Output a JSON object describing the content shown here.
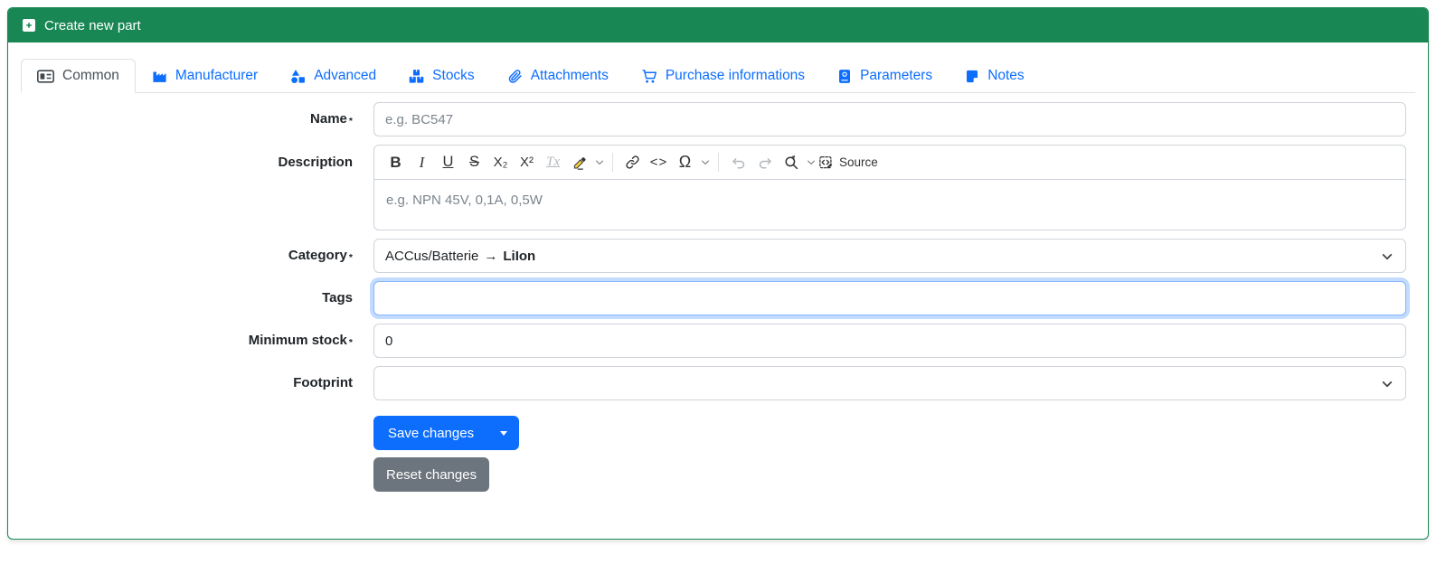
{
  "window": {
    "title": "Create new part"
  },
  "colors": {
    "header_green": "#198754",
    "tab_link_blue": "#0d6efd",
    "primary_button_blue": "#0d6efd",
    "secondary_button_gray": "#6c757d",
    "focus_ring_blue": "#86b7fe"
  },
  "tabs": [
    {
      "label": "Common",
      "icon": "address-card-icon",
      "active": true
    },
    {
      "label": "Manufacturer",
      "icon": "factory-icon",
      "active": false
    },
    {
      "label": "Advanced",
      "icon": "shapes-icon",
      "active": false
    },
    {
      "label": "Stocks",
      "icon": "boxes-stacked-icon",
      "active": false
    },
    {
      "label": "Attachments",
      "icon": "paperclip-icon",
      "active": false
    },
    {
      "label": "Purchase informations",
      "icon": "shopping-cart-icon",
      "active": false
    },
    {
      "label": "Parameters",
      "icon": "address-book-icon",
      "active": false
    },
    {
      "label": "Notes",
      "icon": "sticky-note-icon",
      "active": false
    }
  ],
  "form": {
    "name": {
      "label": "Name",
      "required": "*",
      "placeholder": "e.g. BC547",
      "value": ""
    },
    "description": {
      "label": "Description",
      "placeholder": "e.g. NPN 45V, 0,1A, 0,5W",
      "value": ""
    },
    "category": {
      "label": "Category",
      "required": "*",
      "value_path": "ACCus/Batterie",
      "value_arrow": "→",
      "value_selected": "LiIon"
    },
    "tags": {
      "label": "Tags",
      "value": "",
      "focused": true
    },
    "minimum_stock": {
      "label": "Minimum stock",
      "required": "*",
      "value": "0"
    },
    "footprint": {
      "label": "Footprint",
      "value": ""
    }
  },
  "editor_toolbar": {
    "bold_label": "B",
    "italic_label": "I",
    "underline_label": "U",
    "strikethrough_label": "S",
    "subscript_label": "X₂",
    "superscript_label": "X²",
    "remove_format_label": "Tx",
    "code_label": "<>",
    "special_character_label": "Ω",
    "source_label": "Source",
    "icons": [
      "highlight-marker-icon",
      "link-icon",
      "undo-icon",
      "redo-icon",
      "find-replace-icon",
      "source-editing-icon"
    ]
  },
  "buttons": {
    "save": "Save changes",
    "reset": "Reset changes"
  }
}
